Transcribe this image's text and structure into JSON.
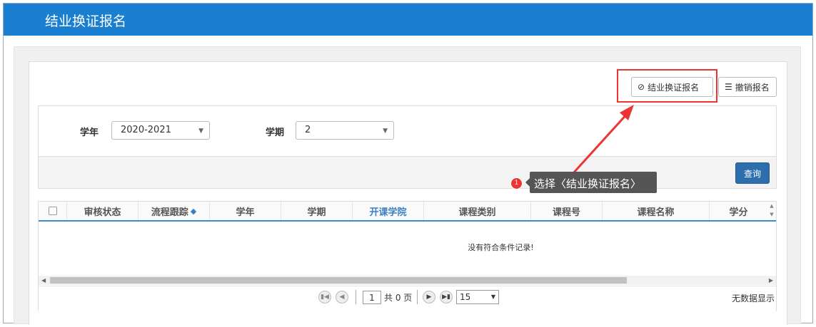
{
  "page": {
    "title": "结业换证报名"
  },
  "toolbar": {
    "apply_label": "结业换证报名",
    "cancel_label": "撤销报名"
  },
  "filters": {
    "year_label": "学年",
    "year_value": "2020-2021",
    "term_label": "学期",
    "term_value": "2",
    "query_label": "查询"
  },
  "table": {
    "columns": [
      "审核状态",
      "流程跟踪",
      "学年",
      "学期",
      "开课学院",
      "课程类别",
      "课程号",
      "课程名称",
      "学分"
    ],
    "empty_message": "没有符合条件记录!"
  },
  "pagination": {
    "current_page": "1",
    "total_text": "共 0 页",
    "page_size": "15",
    "info_text": "无数据显示"
  },
  "annotation": {
    "step": "1",
    "text": "选择〈结业换证报名〉"
  },
  "colors": {
    "titlebar": "#1a7fd0",
    "highlight": "#e33333",
    "query_button": "#2d6fad",
    "header_link": "#3a7fc1"
  }
}
